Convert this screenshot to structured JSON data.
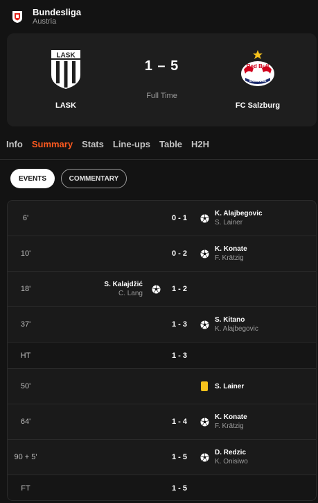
{
  "league": {
    "name": "Bundesliga",
    "country": "Austria",
    "logo_icon": "bundesliga-austria-logo-icon"
  },
  "match": {
    "home": {
      "name": "LASK",
      "logo_text": "LASK"
    },
    "away": {
      "name": "FC Salzburg",
      "logo_text": "Red Bull",
      "logo_subtext": "SALZBURG"
    },
    "score": "1 – 5",
    "status": "Full Time"
  },
  "tabs": [
    {
      "label": "Info",
      "active": false
    },
    {
      "label": "Summary",
      "active": true
    },
    {
      "label": "Stats",
      "active": false
    },
    {
      "label": "Line-ups",
      "active": false
    },
    {
      "label": "Table",
      "active": false
    },
    {
      "label": "H2H",
      "active": false
    }
  ],
  "pills": {
    "events": "EVENTS",
    "commentary": "COMMENTARY"
  },
  "events": [
    {
      "minute": "6'",
      "score": "0 - 1",
      "side": "away",
      "type": "goal",
      "player": "K. Alajbegovic",
      "assist": "S. Lainer"
    },
    {
      "minute": "10'",
      "score": "0 - 2",
      "side": "away",
      "type": "goal",
      "player": "K. Konate",
      "assist": "F. Krätzig"
    },
    {
      "minute": "18'",
      "score": "1 - 2",
      "side": "home",
      "type": "goal",
      "player": "S. Kalajdžić",
      "assist": "C. Lang"
    },
    {
      "minute": "37'",
      "score": "1 - 3",
      "side": "away",
      "type": "goal",
      "player": "S. Kitano",
      "assist": "K. Alajbegovic"
    },
    {
      "minute": "HT",
      "score": "1 - 3",
      "side": "none",
      "type": "period"
    },
    {
      "minute": "50'",
      "score": "",
      "side": "away",
      "type": "yellow-card",
      "player": "S. Lainer"
    },
    {
      "minute": "64'",
      "score": "1 - 4",
      "side": "away",
      "type": "goal",
      "player": "K. Konate",
      "assist": "F. Krätzig"
    },
    {
      "minute": "90 + 5'",
      "score": "1 - 5",
      "side": "away",
      "type": "goal",
      "player": "D. Redzic",
      "assist": "K. Onisiwo"
    },
    {
      "minute": "FT",
      "score": "1 - 5",
      "side": "none",
      "type": "period"
    }
  ],
  "colors": {
    "accent": "#ff5a1f",
    "yellow_card": "#f6c21c",
    "background": "#131313"
  }
}
